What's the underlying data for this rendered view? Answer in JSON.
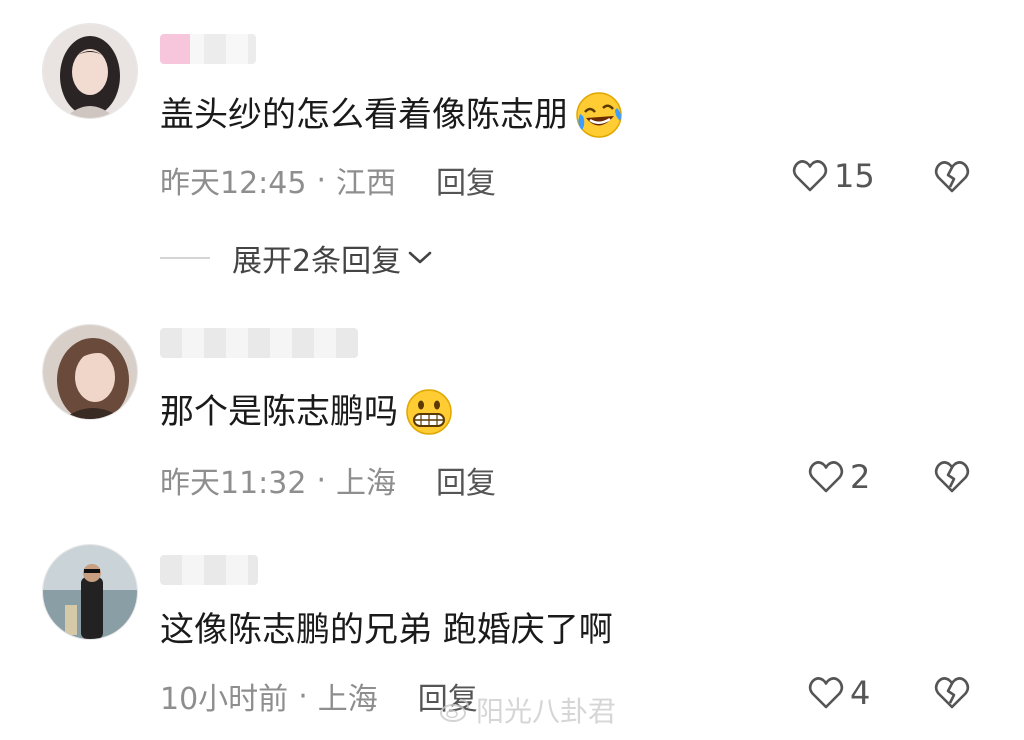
{
  "comments": [
    {
      "text": "盖头纱的怎么看着像陈志朋",
      "emoji": "laughing-tears-emoji",
      "time": "昨天12:45",
      "location": "江西",
      "reply_label": "回复",
      "likes": "15",
      "expand_replies": "展开2条回复"
    },
    {
      "text": "那个是陈志鹏吗",
      "emoji": "grinning-emoji",
      "time": "昨天11:32",
      "location": "上海",
      "reply_label": "回复",
      "likes": "2"
    },
    {
      "text": "这像陈志鹏的兄弟 跑婚庆了啊",
      "time": "10小时前",
      "location": "上海",
      "reply_label": "回复",
      "likes": "4"
    }
  ],
  "separator": "·",
  "watermark": "阳光八卦君",
  "icons": {
    "like": "heart-outline-icon",
    "dislike": "broken-heart-icon",
    "expand": "chevron-down-icon",
    "watermark": "weibo-logo-icon"
  },
  "colors": {
    "text": "#1a1a1a",
    "meta": "#8e8e8e",
    "emoji_yellow": "#ffcc33"
  }
}
